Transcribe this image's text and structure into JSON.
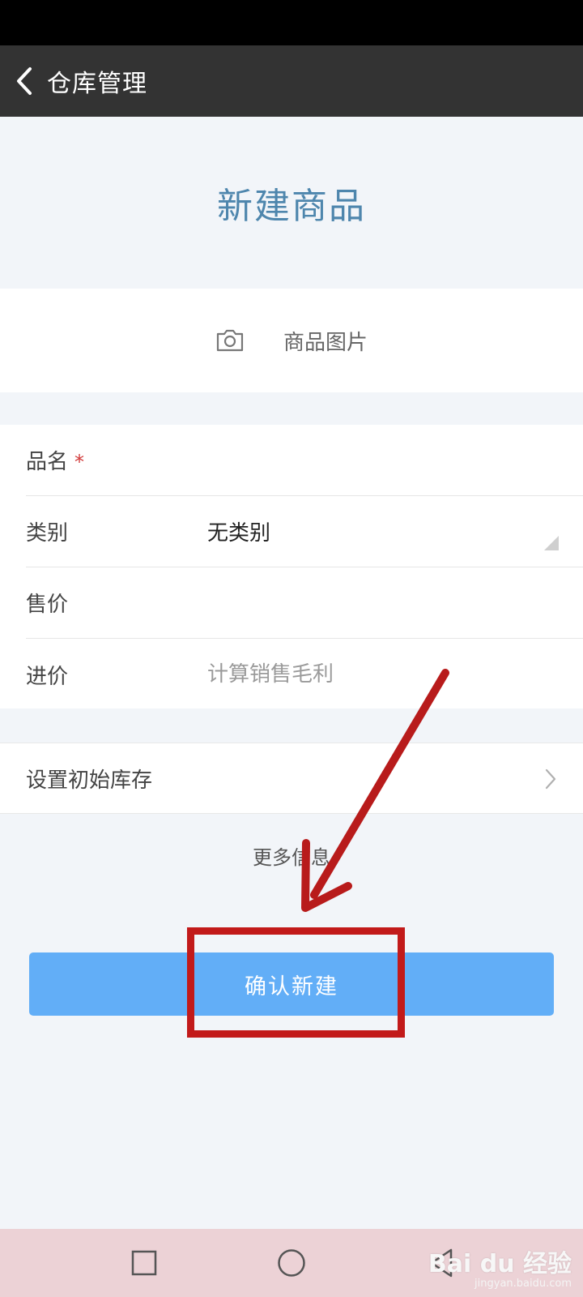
{
  "nav": {
    "title": "仓库管理"
  },
  "header": {
    "title": "新建商品"
  },
  "photo": {
    "label": "商品图片"
  },
  "form": {
    "name": {
      "label": "品名",
      "required_mark": "*"
    },
    "category": {
      "label": "类别",
      "value": "无类别"
    },
    "price": {
      "label": "售价"
    },
    "cost": {
      "label": "进价",
      "placeholder": "计算销售毛利"
    }
  },
  "stock": {
    "label": "设置初始库存"
  },
  "more_info": "更多信息",
  "confirm_button": "确认新建",
  "watermark": {
    "brand": "Bai du 经验",
    "url": "jingyan.baidu.com"
  },
  "colors": {
    "nav_bg": "#333333",
    "title": "#4e86ad",
    "primary_button": "#62aef7",
    "annotation": "#c21a1a",
    "required": "#d23a3a"
  },
  "icons": {
    "back": "back-arrow-icon",
    "camera": "camera-icon",
    "dropdown": "dropdown-triangle-icon",
    "chevron": "chevron-right-icon"
  }
}
